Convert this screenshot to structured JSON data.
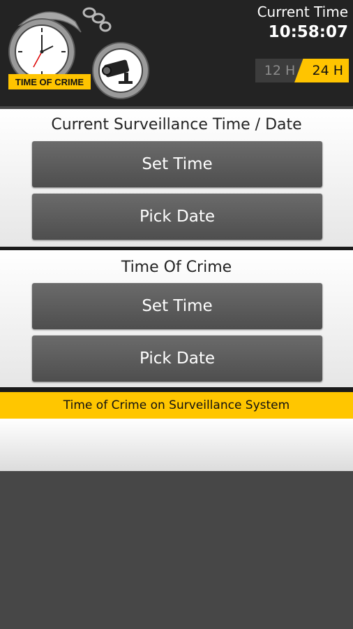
{
  "header": {
    "logo_text": "TIME OF CRIME",
    "current_time_label": "Current Time",
    "current_time_value": "10:58:07",
    "format_toggle": {
      "option_12": "12 H",
      "option_24": "24 H",
      "selected": "24 H"
    }
  },
  "surveillance": {
    "title": "Current Surveillance Time / Date",
    "set_time_label": "Set Time",
    "pick_date_label": "Pick Date"
  },
  "crime": {
    "title": "Time Of Crime",
    "set_time_label": "Set Time",
    "pick_date_label": "Pick Date"
  },
  "result": {
    "banner": "Time of Crime on Surveillance System",
    "value": ""
  },
  "colors": {
    "accent": "#ffc600",
    "header_bg": "#232323",
    "button": "#5a5a5a"
  }
}
